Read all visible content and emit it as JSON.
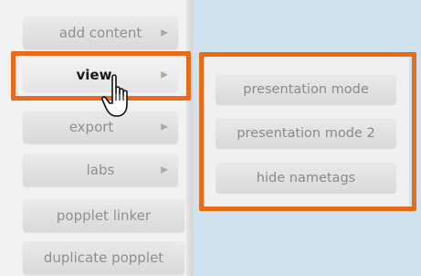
{
  "sidebar": {
    "items": [
      {
        "label": "add content",
        "has_arrow": true
      },
      {
        "label": "view",
        "has_arrow": true,
        "active": true
      },
      {
        "label": "export",
        "has_arrow": true
      },
      {
        "label": "labs",
        "has_arrow": true
      },
      {
        "label": "popplet linker",
        "has_arrow": false
      },
      {
        "label": "duplicate popplet",
        "has_arrow": false
      }
    ],
    "arrow_glyph": "▶"
  },
  "submenu": {
    "items": [
      {
        "label": "presentation mode"
      },
      {
        "label": "presentation mode 2"
      },
      {
        "label": "hide nametags"
      }
    ]
  },
  "colors": {
    "highlight": "#e86b19",
    "canvas": "#cfe2f0",
    "button_text": "#8f8f8f",
    "active_text": "#1a1a1a"
  },
  "icons": {
    "cursor": "hand-pointer-icon",
    "submenu_arrow": "triangle-right-icon"
  }
}
